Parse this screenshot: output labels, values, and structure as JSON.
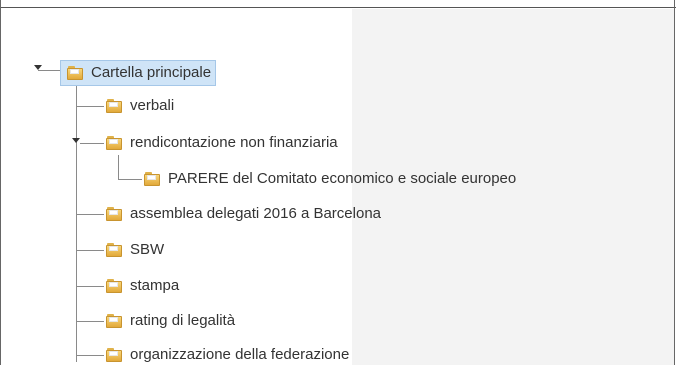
{
  "tree": {
    "root": {
      "label": "Cartella principale",
      "icon": "folder-icon"
    },
    "items": [
      {
        "label": "verbali",
        "icon": "folder-icon"
      },
      {
        "label": "rendicontazione non finanziaria",
        "icon": "folder-icon"
      },
      {
        "label": "PARERE del Comitato economico e sociale europeo",
        "icon": "folder-icon"
      },
      {
        "label": "assemblea delegati 2016 a Barcelona",
        "icon": "folder-icon"
      },
      {
        "label": "SBW",
        "icon": "folder-icon"
      },
      {
        "label": "stampa",
        "icon": "folder-icon"
      },
      {
        "label": "rating di legalità",
        "icon": "folder-icon"
      },
      {
        "label": "organizzazione della federazione",
        "icon": "folder-icon"
      }
    ]
  },
  "colors": {
    "selection": "#cfe4f7",
    "folder": "#e9b84e",
    "panel": "#f3f3f3"
  }
}
